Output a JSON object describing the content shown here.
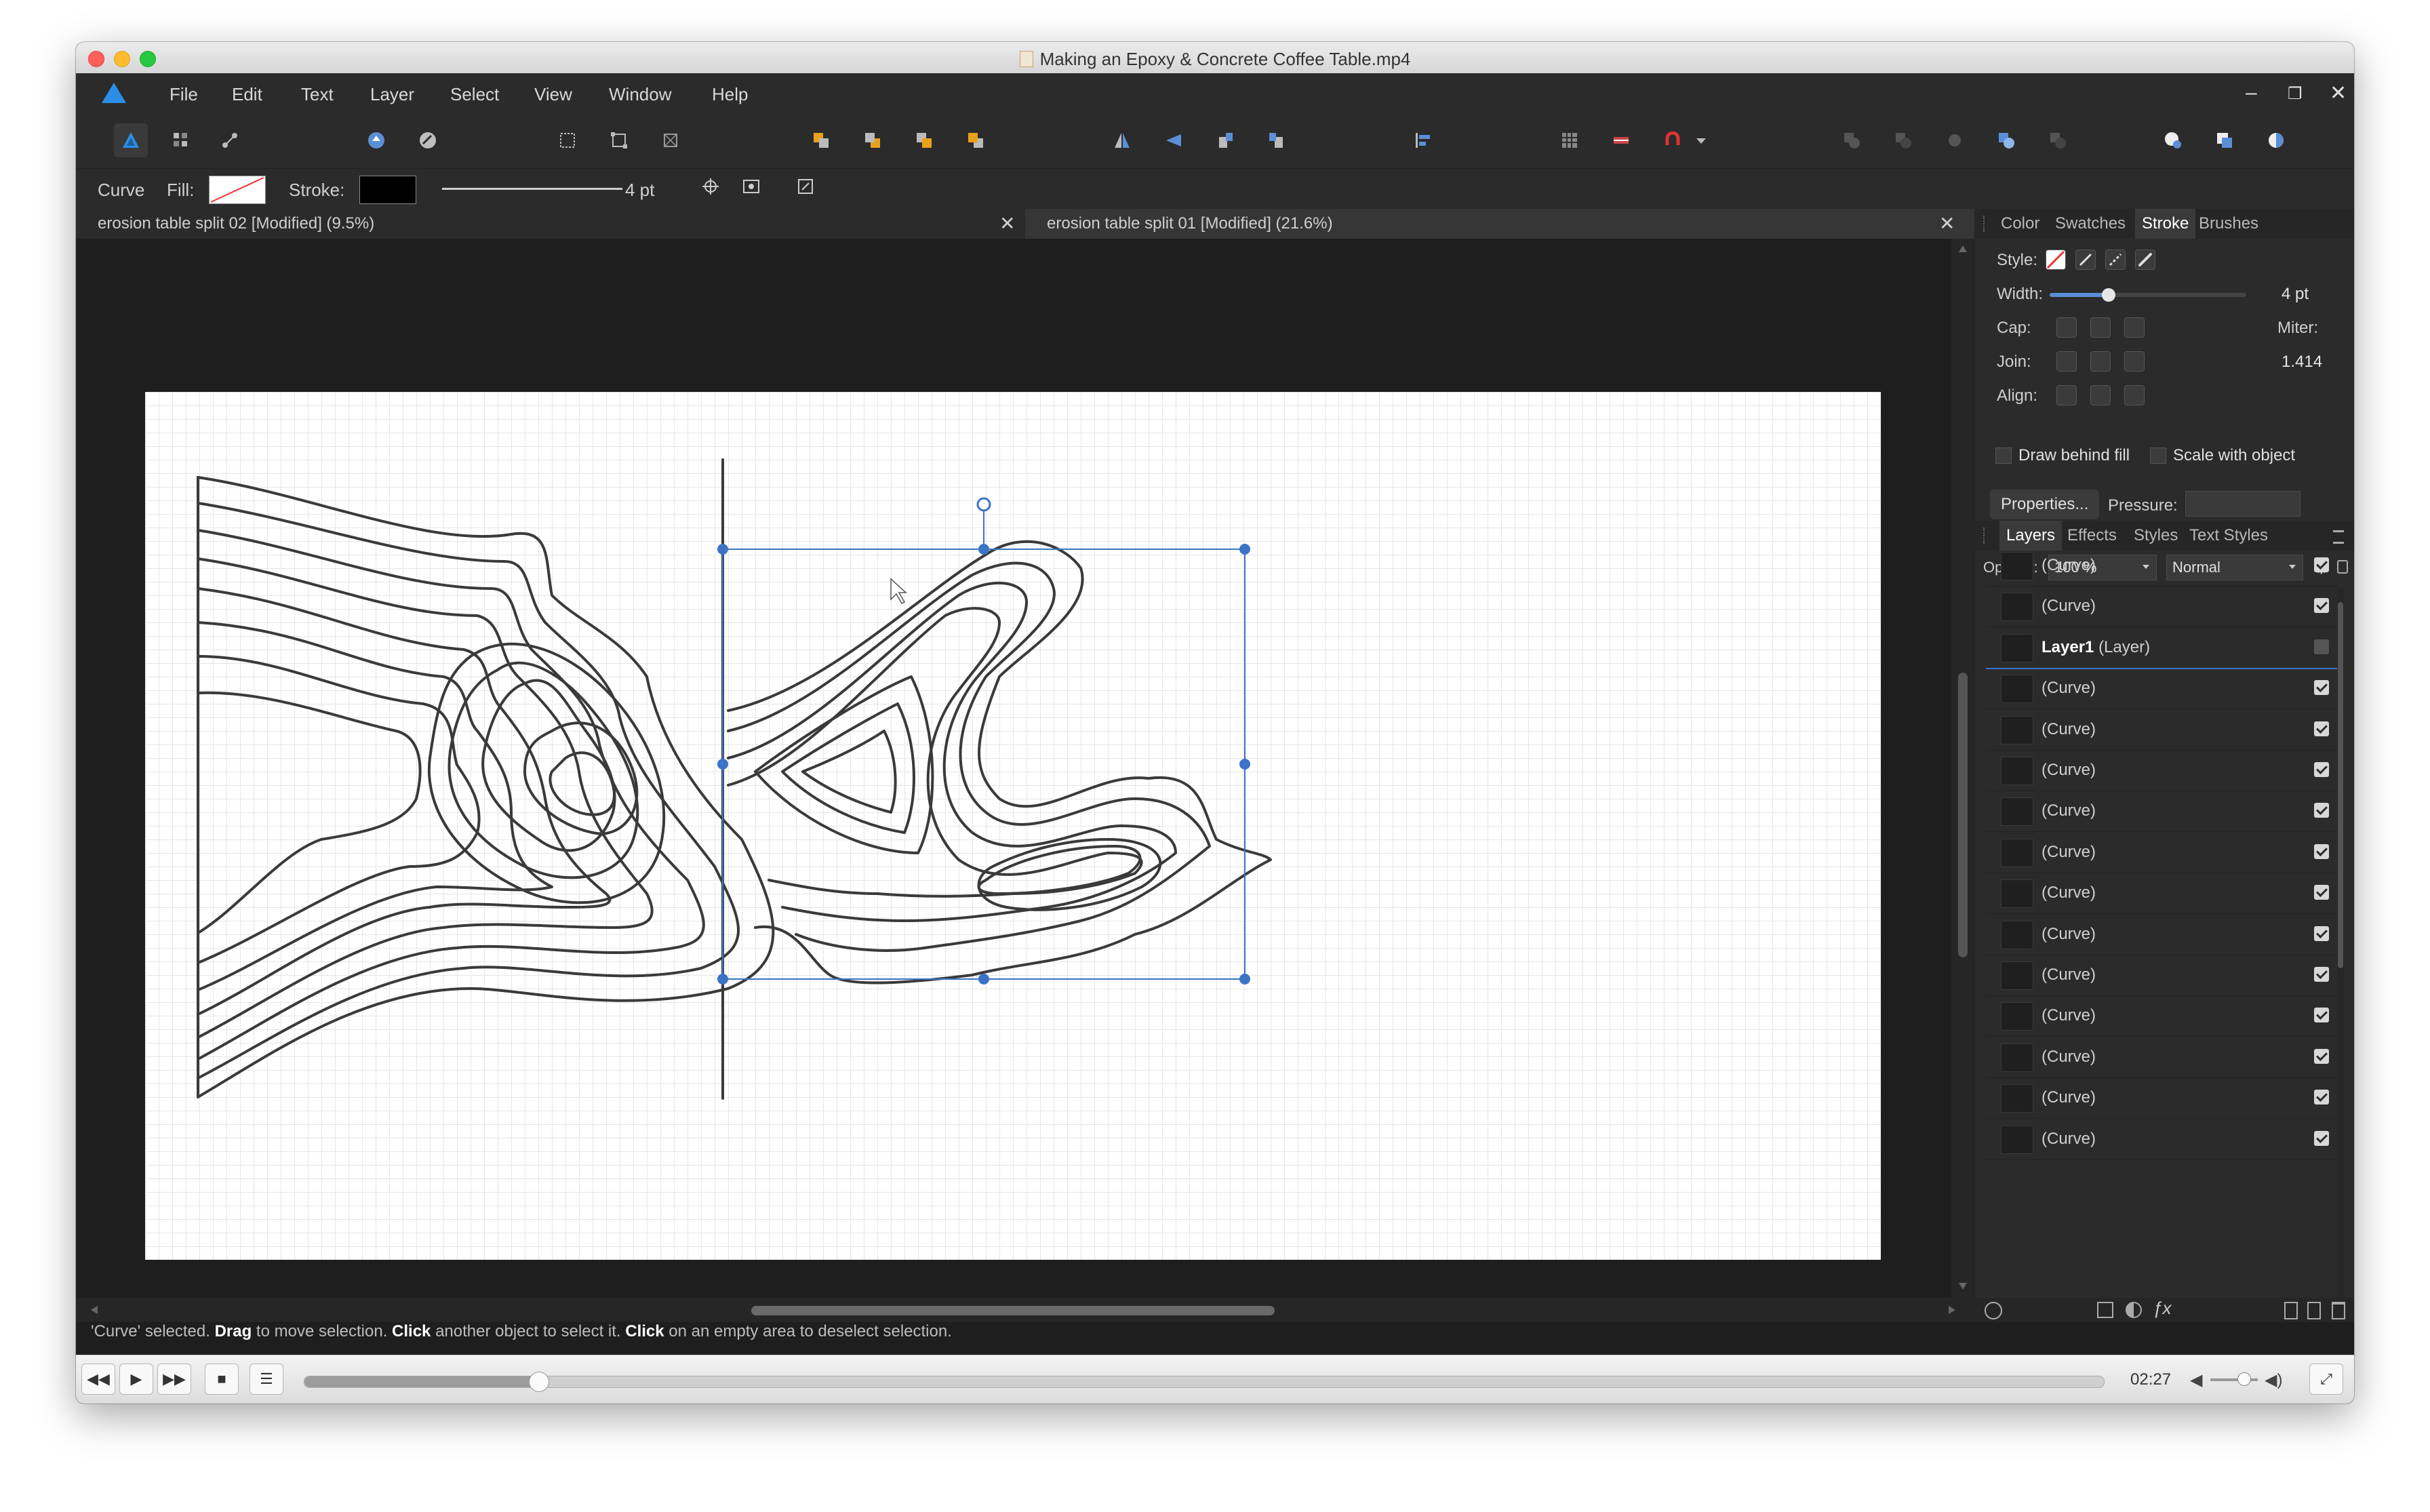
{
  "window": {
    "title": "Making an Epoxy & Concrete Coffee Table.mp4"
  },
  "menu": {
    "items": [
      "File",
      "Edit",
      "Text",
      "Layer",
      "Select",
      "View",
      "Window",
      "Help"
    ]
  },
  "context": {
    "tool": "Curve",
    "fill_label": "Fill:",
    "stroke_label": "Stroke:",
    "stroke_width": "4 pt"
  },
  "tabs": [
    {
      "title": "erosion table split 02 [Modified] (9.5%)"
    },
    {
      "title": "erosion table split 01 [Modified] (21.6%)"
    }
  ],
  "tab_close_glyph": "✕",
  "status": {
    "text1": "'Curve' selected. ",
    "bold1": "Drag",
    "text2": " to move selection. ",
    "bold2": "Click",
    "text3": " another object to select it. ",
    "bold3": "Click",
    "text4": " on an empty area to deselect selection."
  },
  "player": {
    "time": "02:27",
    "progress": 0.13,
    "volume": 0.7
  },
  "panel_top": {
    "tabs": [
      "Color",
      "Swatches",
      "Stroke",
      "Brushes"
    ],
    "active_tab": "Stroke",
    "style_label": "Style:",
    "width_label": "Width:",
    "width_value": "4 pt",
    "width_slider": 0.3,
    "cap_label": "Cap:",
    "miter_label": "Miter:",
    "join_label": "Join:",
    "miter_value": "1.414",
    "align_label": "Align:",
    "draw_behind_fill": "Draw behind fill",
    "scale_with_object": "Scale with object",
    "properties_button": "Properties...",
    "pressure_label": "Pressure:"
  },
  "panel_layers": {
    "tabs": [
      "Layers",
      "Effects",
      "Styles",
      "Text Styles"
    ],
    "active_tab": "Layers",
    "opacity_label": "Opacity:",
    "opacity_value": "100 %",
    "blend_mode": "Normal",
    "rows": [
      {
        "name": "(Curve)",
        "bold": "",
        "visible": true
      },
      {
        "name": "(Curve)",
        "bold": "",
        "visible": true
      },
      {
        "name": "(Layer)",
        "bold": "Layer1",
        "visible": false
      },
      {
        "name": "(Curve)",
        "bold": "",
        "visible": true
      },
      {
        "name": "(Curve)",
        "bold": "",
        "visible": true
      },
      {
        "name": "(Curve)",
        "bold": "",
        "visible": true
      },
      {
        "name": "(Curve)",
        "bold": "",
        "visible": true
      },
      {
        "name": "(Curve)",
        "bold": "",
        "visible": true
      },
      {
        "name": "(Curve)",
        "bold": "",
        "visible": true
      },
      {
        "name": "(Curve)",
        "bold": "",
        "visible": true
      },
      {
        "name": "(Curve)",
        "bold": "",
        "visible": true
      },
      {
        "name": "(Curve)",
        "bold": "",
        "visible": true
      },
      {
        "name": "(Curve)",
        "bold": "",
        "visible": true
      },
      {
        "name": "(Curve)",
        "bold": "",
        "visible": true
      },
      {
        "name": "(Curve)",
        "bold": "",
        "visible": true
      }
    ]
  },
  "colors": {
    "accent": "#2a8ee8",
    "selection": "#3b73c7",
    "app_bg": "#2b2b2b",
    "canvas_bg": "#1e1e1e"
  }
}
